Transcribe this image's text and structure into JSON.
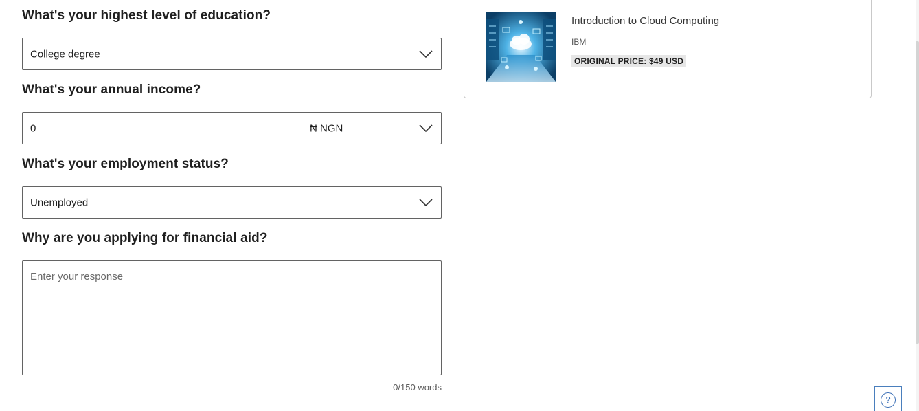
{
  "form": {
    "education": {
      "question": "What's your highest level of education?",
      "selected": "College degree"
    },
    "income": {
      "question": "What's your annual income?",
      "value": "0",
      "currency": "₦ NGN"
    },
    "employment": {
      "question": "What's your employment status?",
      "selected": "Unemployed"
    },
    "reason": {
      "question": "Why are you applying for financial aid?",
      "placeholder": "Enter your response",
      "word_count": "0/150 words"
    }
  },
  "course": {
    "title": "Introduction to Cloud Computing",
    "partner": "IBM",
    "price_label": "ORIGINAL PRICE: $49 USD"
  },
  "help": {
    "icon_glyph": "?"
  },
  "colors": {
    "border": "#636363",
    "help_accent": "#3b6fb6"
  }
}
